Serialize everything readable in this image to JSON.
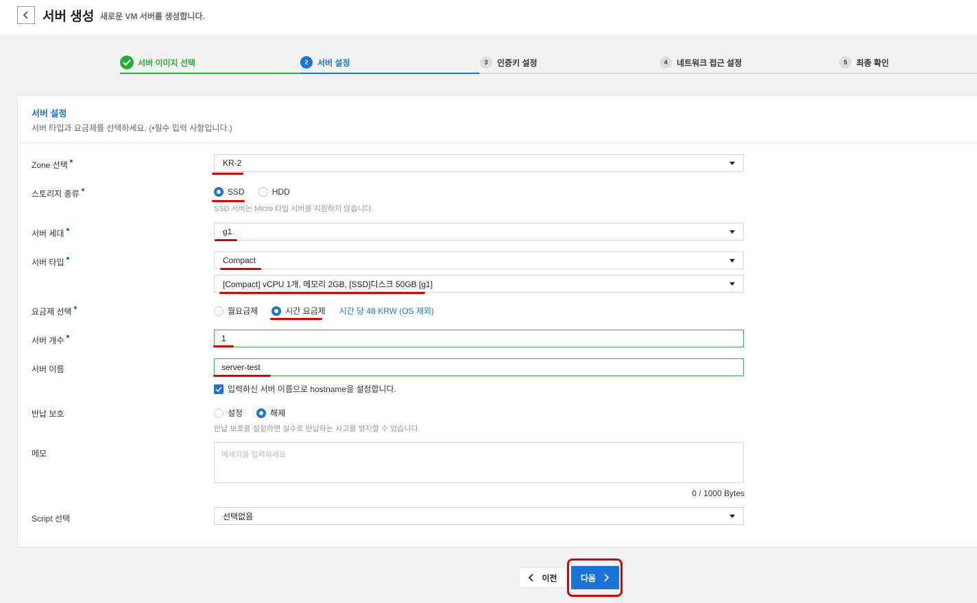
{
  "header": {
    "title": "서버 생성",
    "subtitle": "새로운 VM 서버를 생성합니다."
  },
  "steps": [
    {
      "num": "",
      "label": "서버 이미지 선택",
      "state": "done"
    },
    {
      "num": "2",
      "label": "서버 설정",
      "state": "active"
    },
    {
      "num": "3",
      "label": "인증키 설정",
      "state": "pending"
    },
    {
      "num": "4",
      "label": "네트워크 접근 설정",
      "state": "pending"
    },
    {
      "num": "5",
      "label": "최종 확인",
      "state": "pending"
    }
  ],
  "card": {
    "title": "서버 설정",
    "desc_prefix": "서버 타입과 요금제를 선택하세요. (",
    "desc_dot": "•",
    "desc_suffix": "필수 입력 사항입니다.)"
  },
  "form": {
    "zone": {
      "label": "Zone 선택",
      "value": "KR-2"
    },
    "storage": {
      "label": "스토리지 종류",
      "options": [
        "SSD",
        "HDD"
      ],
      "selected": "SSD",
      "help": "SSD 서버는 Micro 타입 서버를 지원하지 않습니다."
    },
    "generation": {
      "label": "서버 세대",
      "value": "g1"
    },
    "server_type": {
      "label": "서버 타입",
      "value": "Compact",
      "spec_value": "[Compact] vCPU 1개, 메모리 2GB, [SSD]디스크 50GB [g1]"
    },
    "pricing": {
      "label": "요금제 선택",
      "options": [
        "월요금제",
        "시간 요금제"
      ],
      "selected": "시간 요금제",
      "price_text": "시간 당 48 KRW (OS 제외)"
    },
    "count": {
      "label": "서버 개수",
      "value": "1"
    },
    "name": {
      "label": "서버 이름",
      "value": "server-test",
      "checkbox_label": "입력하신 서버 이름으로 hostname을 설정합니다."
    },
    "return_protect": {
      "label": "반납 보호",
      "options": [
        "설정",
        "해제"
      ],
      "selected": "해제",
      "help": "반납 보호를 설정하면 실수로 반납하는 사고를 방지할 수 있습니다."
    },
    "memo": {
      "label": "메모",
      "placeholder": "메세지를 입력하세요",
      "counter": "0 / 1000 Bytes"
    },
    "script": {
      "label": "Script 선택",
      "value": "선택없음"
    }
  },
  "buttons": {
    "prev": "이전",
    "next": "다음"
  },
  "colors": {
    "accent": "#1a73d9",
    "success": "#27ae3a",
    "annotation": "#e00000"
  }
}
